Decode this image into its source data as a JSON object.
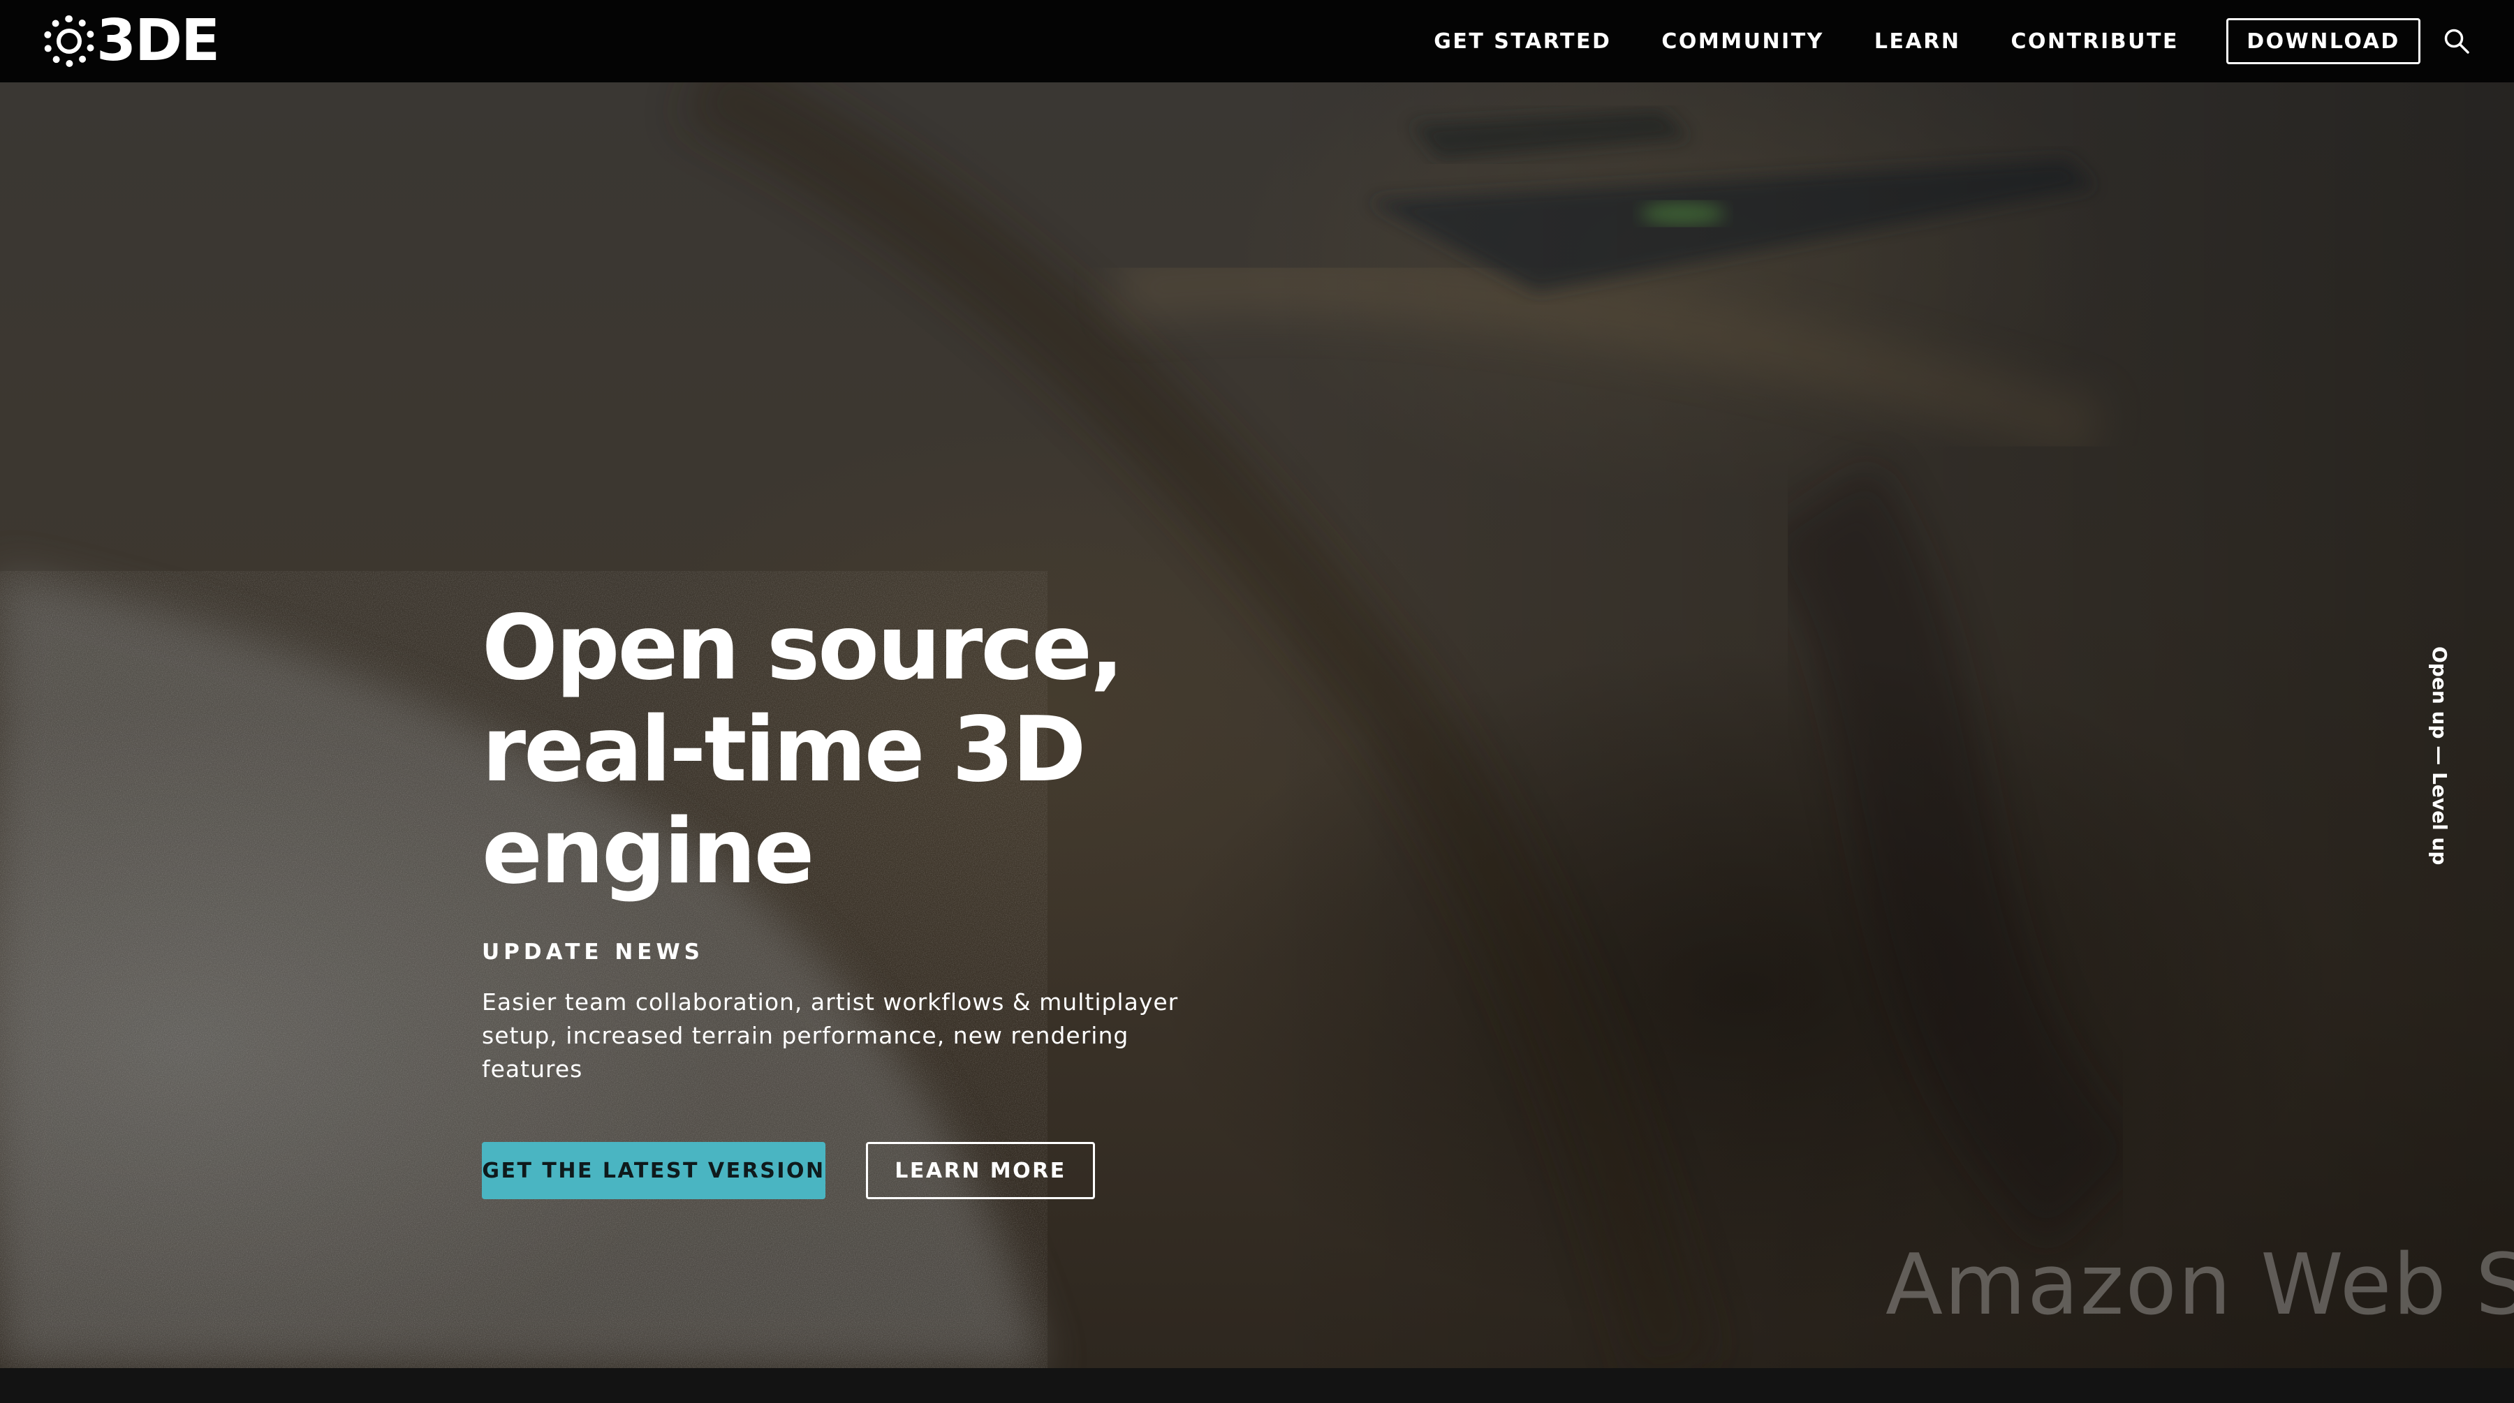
{
  "brand": {
    "logo_text": "3DE",
    "logo_initial": "O"
  },
  "nav": {
    "links": [
      {
        "label": "GET STARTED"
      },
      {
        "label": "COMMUNITY"
      },
      {
        "label": "LEARN"
      },
      {
        "label": "CONTRIBUTE"
      }
    ],
    "download_label": "DOWNLOAD",
    "search_icon": "search-icon"
  },
  "hero": {
    "title_lines": [
      "Open source,",
      "real-time 3D",
      "engine"
    ],
    "news_label": "UPDATE NEWS",
    "news_text": "Easier team collaboration, artist workflows & multiplayer setup, increased terrain performance, new rendering features",
    "primary_button": "GET THE LATEST VERSION",
    "secondary_button": "LEARN MORE",
    "side_tagline": "Open up — Level up",
    "watermark": "Amazon Web Serv"
  },
  "colors": {
    "accent": "#4ab5c2",
    "nav_background": "#040404",
    "text": "#ffffff"
  }
}
